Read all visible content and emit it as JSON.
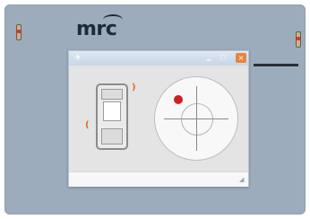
{
  "brand": {
    "logo_text": "mrc"
  },
  "colors": {
    "panel": "#9cacbc",
    "logo": "#1e2a38",
    "window_close": "#e8843c",
    "marker": "#d01e1e",
    "bracket": "#e86a1c"
  },
  "icons": {
    "left_indicator": "battery-indicator-icon",
    "right_indicator": "battery-indicator-icon",
    "window": "window-app-icon",
    "close": "close-icon",
    "resize": "resize-grip-icon"
  },
  "window": {
    "title_icon_glyph": "✈",
    "title": "",
    "close_glyph": "×",
    "grip_glyph": "◢"
  },
  "radar": {
    "marker_x": -0.43,
    "marker_y": 0.45
  }
}
